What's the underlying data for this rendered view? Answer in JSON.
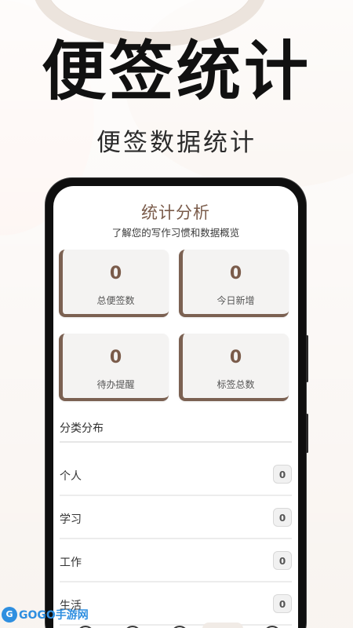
{
  "promo": {
    "headline": "便签统计",
    "subline": "便签数据统计"
  },
  "screen": {
    "title": "统计分析",
    "subtitle": "了解您的写作习惯和数据概览"
  },
  "stats": [
    {
      "value": "0",
      "label": "总便签数"
    },
    {
      "value": "0",
      "label": "今日新增"
    },
    {
      "value": "0",
      "label": "待办提醒"
    },
    {
      "value": "0",
      "label": "标签总数"
    }
  ],
  "categories": {
    "title": "分类分布",
    "items": [
      {
        "label": "个人",
        "count": "0"
      },
      {
        "label": "学习",
        "count": "0"
      },
      {
        "label": "工作",
        "count": "0"
      },
      {
        "label": "生活",
        "count": "0"
      }
    ]
  },
  "watermark": {
    "text": "GOGO手游网"
  },
  "colors": {
    "accent": "#7b6152",
    "title": "#7a5b4a",
    "watermark": "#2f8fe0"
  }
}
